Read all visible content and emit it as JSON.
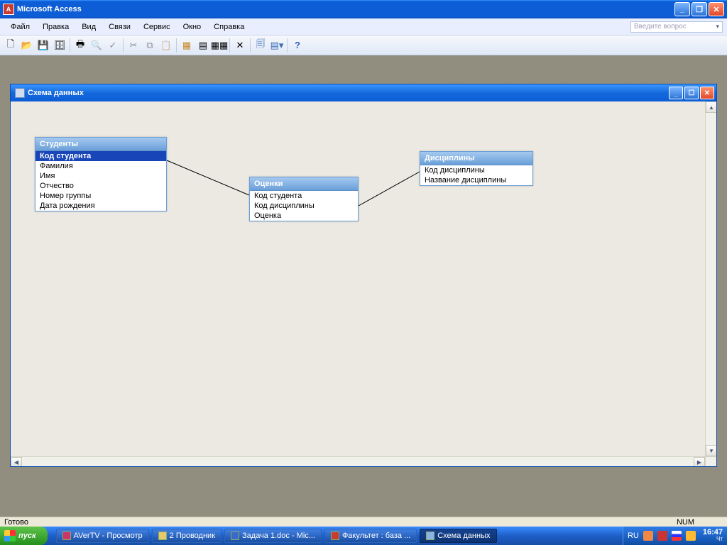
{
  "app": {
    "title": "Microsoft Access"
  },
  "menu": {
    "items": [
      "Файл",
      "Правка",
      "Вид",
      "Связи",
      "Сервис",
      "Окно",
      "Справка"
    ],
    "help_placeholder": "Введите вопрос"
  },
  "child": {
    "title": "Схема данных"
  },
  "tables": {
    "students": {
      "title": "Студенты",
      "fields": [
        "Код студента",
        "Фамилия",
        "Имя",
        "Отчество",
        "Номер группы",
        "Дата рождения"
      ],
      "selected": 0
    },
    "grades": {
      "title": "Оценки",
      "fields": [
        "Код студента",
        "Код дисциплины",
        "Оценка"
      ]
    },
    "subjects": {
      "title": "Дисциплины",
      "fields": [
        "Код дисциплины",
        "Название дисциплины"
      ]
    }
  },
  "status": {
    "ready": "Готово",
    "num": "NUM"
  },
  "taskbar": {
    "start": "пуск",
    "items": [
      {
        "label": "AVerTV - Просмотр",
        "active": false
      },
      {
        "label": "2 Проводник",
        "active": false
      },
      {
        "label": "Задача 1.doc - Mic...",
        "active": false
      },
      {
        "label": "Факультет : база ...",
        "active": false
      },
      {
        "label": "Схема данных",
        "active": true
      }
    ],
    "lang": "RU",
    "clock": "16:47",
    "clock_sub": "Чт"
  }
}
